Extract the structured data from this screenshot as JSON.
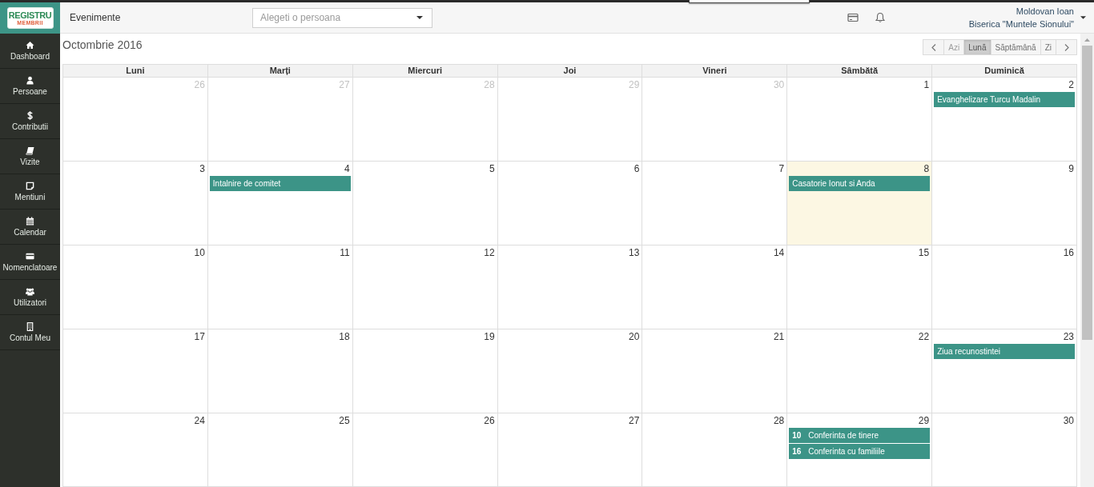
{
  "logo": {
    "title": "REGISTRU",
    "subtitle": "MEMBRII"
  },
  "header": {
    "page_title": "Evenimente",
    "person_select": {
      "placeholder": "Alegeti o persoana"
    },
    "user": {
      "name": "Moldovan Ioan",
      "organization": "Biserica \"Muntele Sionului\""
    }
  },
  "sidebar": {
    "items": [
      {
        "label": "Dashboard"
      },
      {
        "label": "Persoane"
      },
      {
        "label": "Contributii"
      },
      {
        "label": "Vizite"
      },
      {
        "label": "Mentiuni"
      },
      {
        "label": "Calendar"
      },
      {
        "label": "Nomenclatoare"
      },
      {
        "label": "Utilizatori"
      },
      {
        "label": "Contul Meu"
      }
    ]
  },
  "calendar": {
    "title": "Octombrie 2016",
    "view_buttons": [
      {
        "label": "Azi",
        "selected": false,
        "disabled": true
      },
      {
        "label": "Lună",
        "selected": true,
        "disabled": false
      },
      {
        "label": "Săptămână",
        "selected": false,
        "disabled": false
      },
      {
        "label": "Zi",
        "selected": false,
        "disabled": false
      }
    ],
    "weekdays": [
      "Luni",
      "Marți",
      "Miercuri",
      "Joi",
      "Vineri",
      "Sâmbătă",
      "Duminică"
    ],
    "weeks": [
      {
        "days": [
          {
            "day": "26",
            "other_month": true,
            "today": false
          },
          {
            "day": "27",
            "other_month": true,
            "today": false
          },
          {
            "day": "28",
            "other_month": true,
            "today": false
          },
          {
            "day": "29",
            "other_month": true,
            "today": false
          },
          {
            "day": "30",
            "other_month": true,
            "today": false
          },
          {
            "day": "1",
            "other_month": false,
            "today": false
          },
          {
            "day": "2",
            "other_month": false,
            "today": false,
            "events": [
              {
                "title": "Evanghelizare Turcu Madalin"
              }
            ]
          }
        ]
      },
      {
        "days": [
          {
            "day": "3",
            "other_month": false,
            "today": false
          },
          {
            "day": "4",
            "other_month": false,
            "today": false,
            "events": [
              {
                "title": "Intalnire de comitet"
              }
            ]
          },
          {
            "day": "5",
            "other_month": false,
            "today": false
          },
          {
            "day": "6",
            "other_month": false,
            "today": false
          },
          {
            "day": "7",
            "other_month": false,
            "today": false
          },
          {
            "day": "8",
            "other_month": false,
            "today": true,
            "events": [
              {
                "title": "Casatorie Ionut si Anda"
              }
            ]
          },
          {
            "day": "9",
            "other_month": false,
            "today": false
          }
        ]
      },
      {
        "days": [
          {
            "day": "10",
            "other_month": false,
            "today": false
          },
          {
            "day": "11",
            "other_month": false,
            "today": false
          },
          {
            "day": "12",
            "other_month": false,
            "today": false
          },
          {
            "day": "13",
            "other_month": false,
            "today": false
          },
          {
            "day": "14",
            "other_month": false,
            "today": false
          },
          {
            "day": "15",
            "other_month": false,
            "today": false
          },
          {
            "day": "16",
            "other_month": false,
            "today": false
          }
        ]
      },
      {
        "days": [
          {
            "day": "17",
            "other_month": false,
            "today": false
          },
          {
            "day": "18",
            "other_month": false,
            "today": false
          },
          {
            "day": "19",
            "other_month": false,
            "today": false
          },
          {
            "day": "20",
            "other_month": false,
            "today": false
          },
          {
            "day": "21",
            "other_month": false,
            "today": false
          },
          {
            "day": "22",
            "other_month": false,
            "today": false
          },
          {
            "day": "23",
            "other_month": false,
            "today": false,
            "events": [
              {
                "title": "Ziua recunostintei"
              }
            ]
          }
        ]
      },
      {
        "days": [
          {
            "day": "24",
            "other_month": false,
            "today": false
          },
          {
            "day": "25",
            "other_month": false,
            "today": false
          },
          {
            "day": "26",
            "other_month": false,
            "today": false
          },
          {
            "day": "27",
            "other_month": false,
            "today": false
          },
          {
            "day": "28",
            "other_month": false,
            "today": false
          },
          {
            "day": "29",
            "other_month": false,
            "today": false,
            "events": [
              {
                "time": "10",
                "title": "Conferinta de tinere"
              },
              {
                "time": "16",
                "title": "Conferinta cu familiile"
              }
            ]
          },
          {
            "day": "30",
            "other_month": false,
            "today": false
          }
        ]
      }
    ]
  }
}
